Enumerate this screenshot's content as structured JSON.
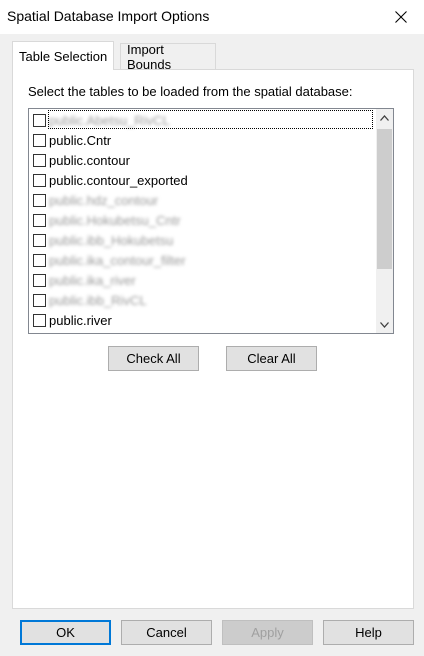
{
  "window": {
    "title": "Spatial Database Import Options"
  },
  "tabs": [
    {
      "label": "Table Selection",
      "active": true
    },
    {
      "label": "Import Bounds",
      "active": false
    }
  ],
  "panel": {
    "instruction": "Select the tables to be loaded from the spatial database:",
    "tables": [
      {
        "label": "public.Abetsu_RivCL",
        "checked": false,
        "blurred": true
      },
      {
        "label": "public.Cntr",
        "checked": false,
        "blurred": false
      },
      {
        "label": "public.contour",
        "checked": false,
        "blurred": false
      },
      {
        "label": "public.contour_exported",
        "checked": false,
        "blurred": false
      },
      {
        "label": "public.hdz_contour",
        "checked": false,
        "blurred": true
      },
      {
        "label": "public.Hokubetsu_Cntr",
        "checked": false,
        "blurred": true
      },
      {
        "label": "public.ibb_Hokubetsu",
        "checked": false,
        "blurred": true
      },
      {
        "label": "public.ika_contour_filter",
        "checked": false,
        "blurred": true
      },
      {
        "label": "public.ika_river",
        "checked": false,
        "blurred": true
      },
      {
        "label": "public.ibb_RivCL",
        "checked": false,
        "blurred": true
      },
      {
        "label": "public.river",
        "checked": false,
        "blurred": false
      }
    ],
    "check_all": "Check All",
    "clear_all": "Clear All"
  },
  "footer": {
    "ok": "OK",
    "cancel": "Cancel",
    "apply": "Apply",
    "help": "Help"
  },
  "colors": {
    "accent": "#0078d7",
    "panel_bg": "#ffffff",
    "window_bg": "#f0f0f0"
  },
  "icons": {
    "close": "close-icon",
    "scroll_up": "chevron-up-icon",
    "scroll_down": "chevron-down-icon"
  }
}
